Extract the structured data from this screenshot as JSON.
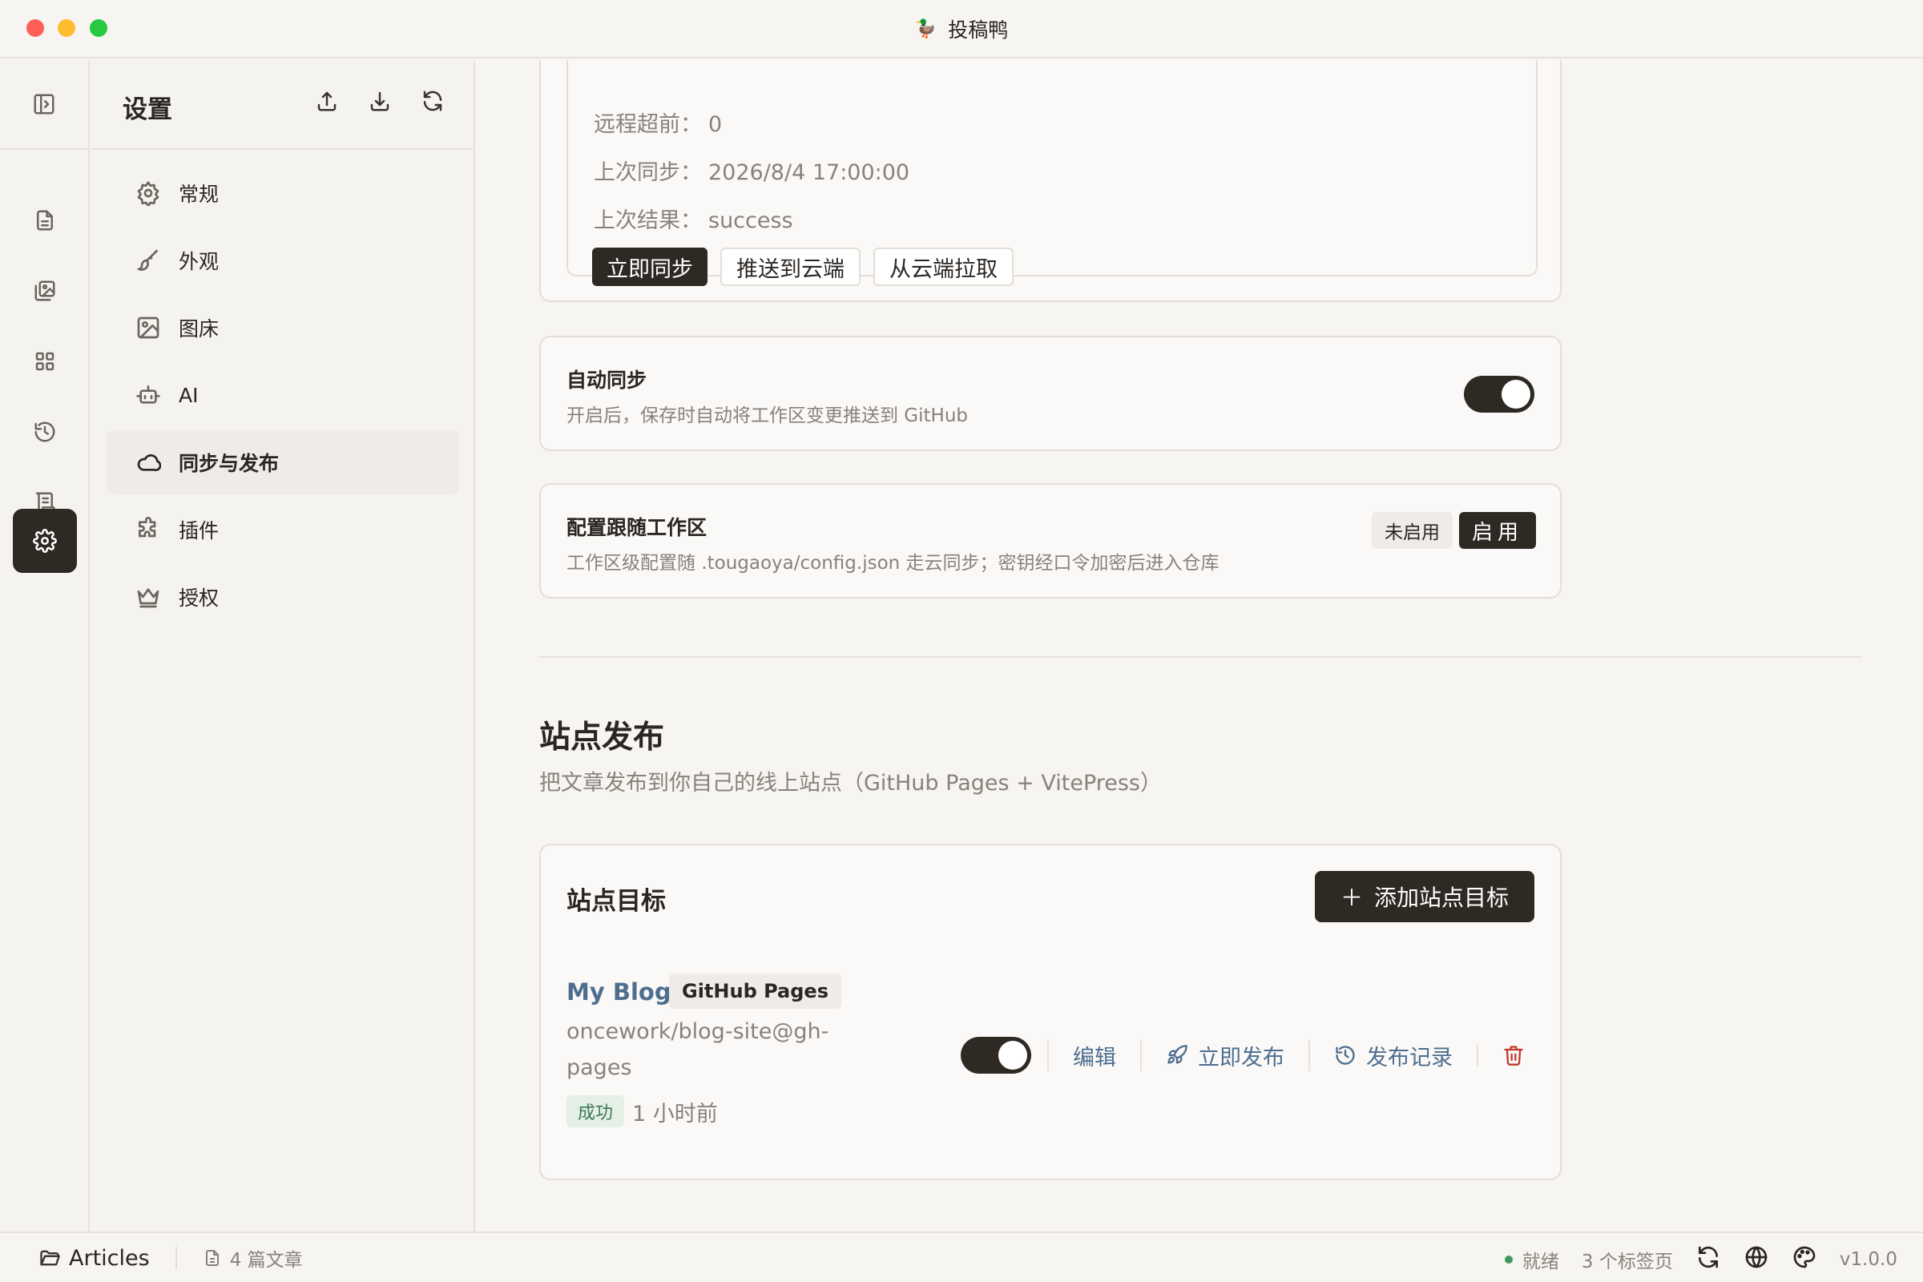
{
  "window": {
    "title": "投稿鸭",
    "logo_glyph": "🦆"
  },
  "rail": {
    "items": [
      {
        "name": "document-icon"
      },
      {
        "name": "images-icon"
      },
      {
        "name": "grid-icon"
      },
      {
        "name": "history-icon"
      },
      {
        "name": "scroll-icon"
      },
      {
        "name": "settings-gear-icon",
        "active": true
      }
    ]
  },
  "settings_nav": {
    "title": "设置",
    "items": [
      {
        "label": "常规",
        "icon": "gear-icon"
      },
      {
        "label": "外观",
        "icon": "brush-icon"
      },
      {
        "label": "图床",
        "icon": "image-icon"
      },
      {
        "label": "AI",
        "icon": "robot-icon"
      },
      {
        "label": "同步与发布",
        "icon": "cloud-icon",
        "active": true
      },
      {
        "label": "插件",
        "icon": "puzzle-icon"
      },
      {
        "label": "授权",
        "icon": "crown-icon"
      }
    ]
  },
  "sync_status": {
    "remote_ahead_label": "远程超前：",
    "remote_ahead_value": "0",
    "last_sync_label": "上次同步：",
    "last_sync_value": "2026/8/4 17:00:00",
    "last_result_label": "上次结果：",
    "last_result_value": "success",
    "btn_sync_now": "立即同步",
    "btn_push": "推送到云端",
    "btn_pull": "从云端拉取"
  },
  "auto_sync": {
    "title": "自动同步",
    "desc": "开启后，保存时自动将工作区变更推送到 GitHub",
    "enabled": true
  },
  "config_follow": {
    "title": "配置跟随工作区",
    "desc": "工作区级配置随 .tougaoya/config.json 走云同步；密钥经口令加密后进入仓库",
    "off_label": "未启用",
    "on_label": "启用"
  },
  "site_publish": {
    "title": "站点发布",
    "desc": "把文章发布到你自己的线上站点（GitHub Pages + VitePress）"
  },
  "site_targets": {
    "title": "站点目标",
    "add_label": "添加站点目标",
    "items": [
      {
        "name": "My Blog",
        "type": "GitHub Pages",
        "repo": "oncework/blog-site@gh-pages",
        "status": "成功",
        "time": "1 小时前",
        "enabled": true,
        "edit_label": "编辑",
        "publish_label": "立即发布",
        "history_label": "发布记录"
      }
    ]
  },
  "statusbar": {
    "folder": "Articles",
    "article_count": "4 篇文章",
    "ready": "就绪",
    "tabs": "3 个标签页",
    "version": "v1.0.0"
  },
  "colors": {
    "accent_dark": "#2f2924",
    "link_blue": "#4d6e8f",
    "success_green": "#3d7a52",
    "danger_red": "#c0392b"
  }
}
